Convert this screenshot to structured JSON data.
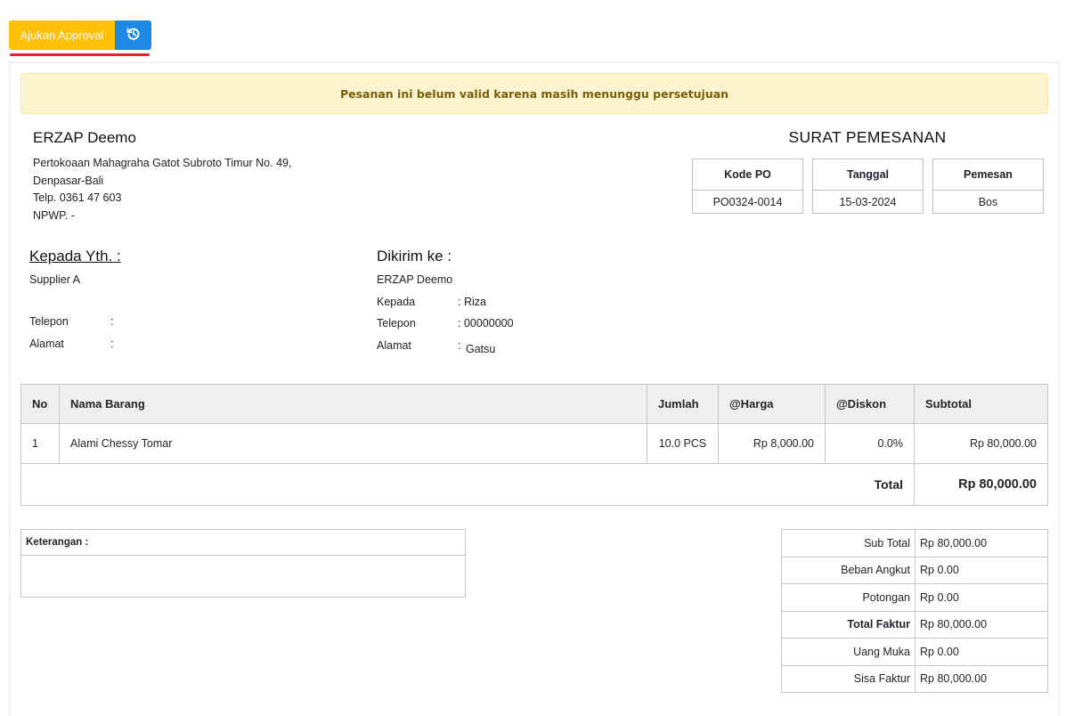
{
  "toolbar": {
    "approval_label": "Ajukan Approval",
    "history_icon": "history-icon",
    "colors": {
      "approval": "#ffc107",
      "history": "#1e88e5",
      "underline": "#e8202a"
    }
  },
  "alert": {
    "message": "Pesanan ini belum valid karena masih menunggu persetujuan"
  },
  "company": {
    "name": "ERZAP Deemo",
    "address_line1": "Pertokoaan Mahagraha Gatot Subroto Timur No. 49,",
    "address_line2": "Denpasar-Bali",
    "phone": "Telp. 0361 47 603",
    "npwp": "NPWP. -"
  },
  "document": {
    "title": "SURAT PEMESANAN",
    "meta": [
      {
        "label": "Kode PO",
        "value": "PO0324-0014"
      },
      {
        "label": "Tanggal",
        "value": "15-03-2024"
      },
      {
        "label": "Pemesan",
        "value": "Bos"
      }
    ]
  },
  "recipient": {
    "heading": "Kepada Yth. :",
    "name": "Supplier A",
    "phone_label": "Telepon",
    "phone_sep": ":",
    "address_label": "Alamat",
    "address_sep": ":"
  },
  "shipping": {
    "heading": "Dikirim ke :",
    "name": "ERZAP Deemo",
    "to_label": "Kepada",
    "to_value": ": Riza",
    "phone_label": "Telepon",
    "phone_value": ": 00000000",
    "address_label": "Alamat",
    "address_sep": ":",
    "address_value": "Gatsu"
  },
  "items_table": {
    "headers": [
      "No",
      "Nama Barang",
      "Jumlah",
      "@Harga",
      "@Diskon",
      "Subtotal"
    ],
    "rows": [
      [
        "1",
        "Alami Chessy Tomar",
        "10.0 PCS",
        "Rp 8,000.00",
        "0.0%",
        "Rp 80,000.00"
      ]
    ],
    "total_label": "Total",
    "total_value": "Rp 80,000.00"
  },
  "notes": {
    "label": "Keterangan :",
    "value": ""
  },
  "summary": [
    {
      "label": "Sub Total",
      "value": "Rp 80,000.00"
    },
    {
      "label": "Beban Angkut",
      "value": "Rp 0.00"
    },
    {
      "label": "Potongan",
      "value": "Rp 0.00"
    },
    {
      "label": "Total Faktur",
      "value": "Rp 80,000.00"
    },
    {
      "label": "Uang Muka",
      "value": "Rp 0.00"
    },
    {
      "label": "Sisa Faktur",
      "value": "Rp 80,000.00"
    }
  ]
}
